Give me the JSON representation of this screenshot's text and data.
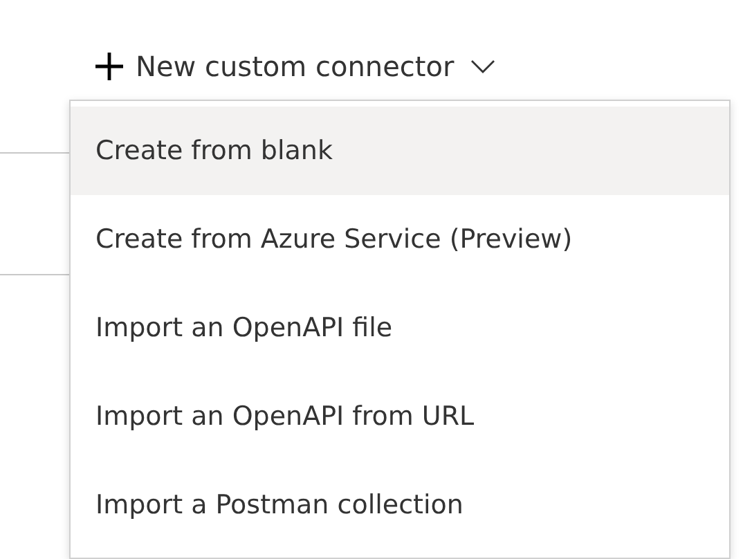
{
  "button": {
    "label": "New custom connector"
  },
  "menu": {
    "items": [
      {
        "label": "Create from blank",
        "selected": true
      },
      {
        "label": "Create from Azure Service (Preview)",
        "selected": false
      },
      {
        "label": "Import an OpenAPI file",
        "selected": false
      },
      {
        "label": "Import an OpenAPI from URL",
        "selected": false
      },
      {
        "label": "Import a Postman collection",
        "selected": false
      }
    ]
  }
}
